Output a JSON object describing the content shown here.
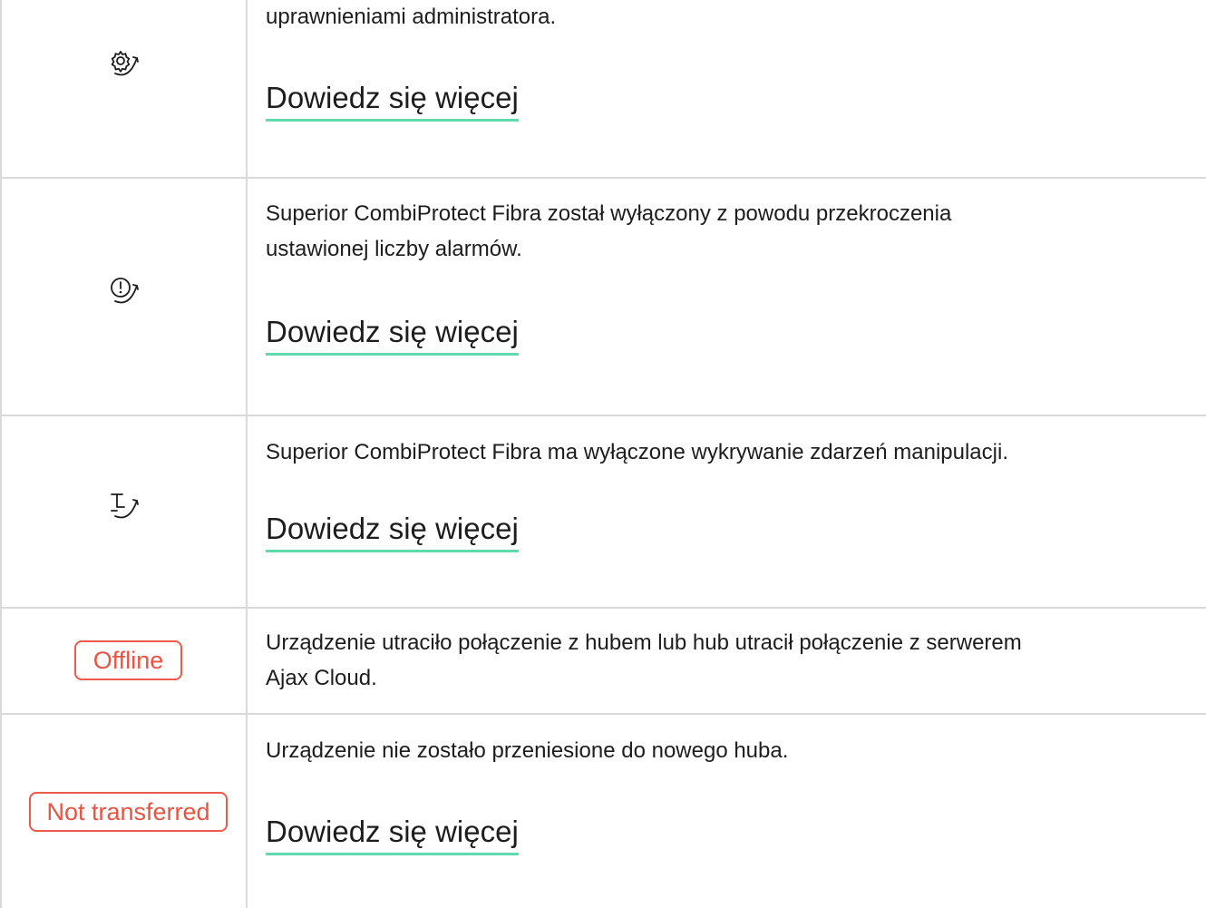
{
  "rows": [
    {
      "icon": "gear-arrow-icon",
      "description": "uprawnieniami administratora.",
      "link": "Dowiedz się więcej"
    },
    {
      "icon": "alert-arrow-icon",
      "description_lines": [
        "Superior CombiProtect Fibra został wyłączony z powodu przekroczenia",
        "ustawionej liczby alarmów."
      ],
      "link": "Dowiedz się więcej"
    },
    {
      "icon": "tamper-arrow-icon",
      "description": "Superior CombiProtect Fibra ma wyłączone wykrywanie zdarzeń manipulacji.",
      "link": "Dowiedz się więcej"
    },
    {
      "badge": "Offline",
      "description_lines": [
        "Urządzenie utraciło połączenie z hubem lub hub utracił połączenie z serwerem",
        "Ajax Cloud."
      ]
    },
    {
      "badge": "Not transferred",
      "description": "Urządzenie nie zostało przeniesione do nowego huba.",
      "link": "Dowiedz się więcej"
    }
  ],
  "colors": {
    "link_underline": "#5fdbad",
    "badge_red": "#e85444",
    "grid_line": "#d9d9d9",
    "text": "#1d1d1d"
  }
}
